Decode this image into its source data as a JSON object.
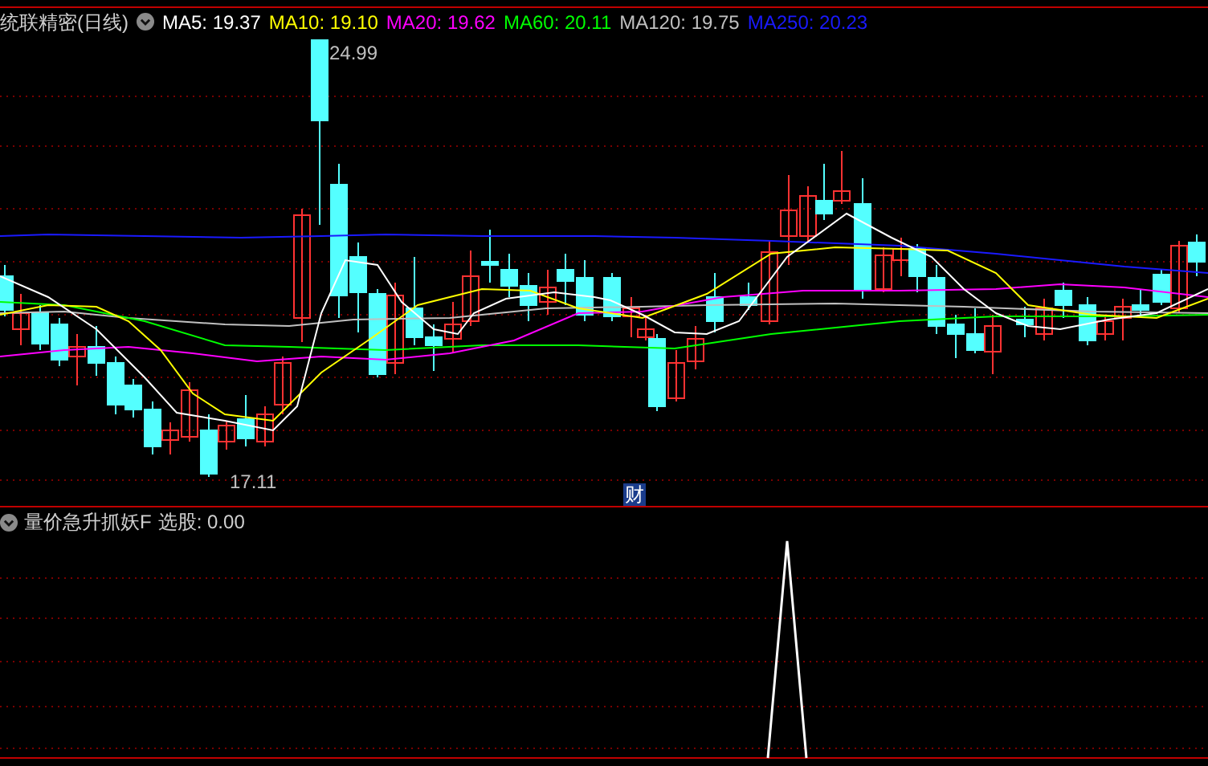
{
  "title": "统联精密(日线)",
  "ma_legend": [
    {
      "label": "MA5: 19.37",
      "color": "#ffffff"
    },
    {
      "label": "MA10: 19.10",
      "color": "#ffff00"
    },
    {
      "label": "MA20: 19.62",
      "color": "#ff00ff"
    },
    {
      "label": "MA60: 20.11",
      "color": "#00ff00"
    },
    {
      "label": "MA120: 19.75",
      "color": "#c0c0c0"
    },
    {
      "label": "MA250: 20.23",
      "color": "#1a1aff"
    }
  ],
  "chart": {
    "high_label": "24.99",
    "low_label": "17.11",
    "badge": "财"
  },
  "indicator": {
    "title": "量价急升抓妖F",
    "reading": "选股: 0.00"
  }
}
